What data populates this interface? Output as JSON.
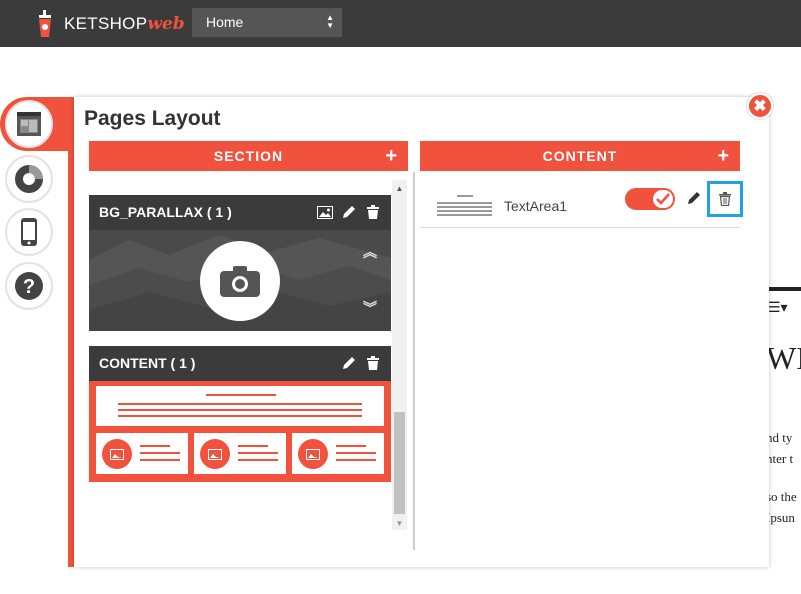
{
  "header": {
    "logo_text": "KETSHOP",
    "logo_web": "web",
    "page_select": "Home"
  },
  "panel": {
    "title": "Pages Layout",
    "close_label": "✖"
  },
  "section_column": {
    "header": "SECTION",
    "add_label": "+",
    "items": [
      {
        "title": "BG_PARALLAX ( 1 )"
      },
      {
        "title": "CONTENT ( 1 )"
      }
    ]
  },
  "content_column": {
    "header": "CONTENT",
    "add_label": "+",
    "items": [
      {
        "label": "TextArea1",
        "enabled": true
      }
    ]
  },
  "background_page": {
    "heading": "WI",
    "lines": [
      "nd ty",
      "nter t",
      "so the",
      "Ipsun"
    ]
  },
  "colors": {
    "accent": "#f0523d",
    "topbar": "#3b3b3b",
    "focus": "#1ea3df"
  }
}
